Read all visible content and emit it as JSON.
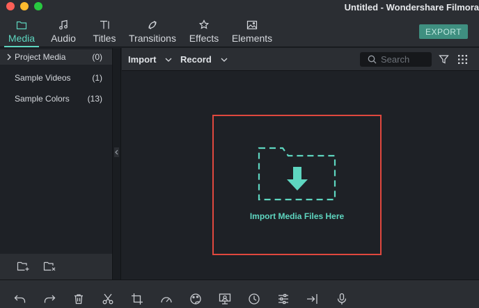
{
  "window": {
    "title": "Untitled - Wondershare Filmora"
  },
  "tabs": [
    {
      "label": "Media",
      "icon": "folder-icon",
      "active": true
    },
    {
      "label": "Audio",
      "icon": "music-note-icon",
      "active": false
    },
    {
      "label": "Titles",
      "icon": "text-icon",
      "active": false
    },
    {
      "label": "Transitions",
      "icon": "transitions-icon",
      "active": false
    },
    {
      "label": "Effects",
      "icon": "effects-icon",
      "active": false
    },
    {
      "label": "Elements",
      "icon": "image-icon",
      "active": false
    }
  ],
  "toolbar": {
    "export_label": "EXPORT"
  },
  "library": {
    "items": [
      {
        "label": "Project Media",
        "count": "(0)"
      },
      {
        "label": "Sample Videos",
        "count": "(1)"
      },
      {
        "label": "Sample Colors",
        "count": "(13)"
      }
    ]
  },
  "mediabar": {
    "import_label": "Import",
    "record_label": "Record",
    "search_placeholder": "Search"
  },
  "dropzone": {
    "label": "Import Media Files Here"
  },
  "colors": {
    "accent": "#5ed6c0",
    "dropzone_border": "#e0483e",
    "export_bg": "#3f8f80"
  },
  "bottom_tools": [
    "undo-icon",
    "redo-icon",
    "delete-icon",
    "cut-icon",
    "crop-icon",
    "speed-icon",
    "color-icon",
    "green-screen-icon",
    "duration-icon",
    "adjust-icon",
    "split-icon",
    "voiceover-icon"
  ]
}
